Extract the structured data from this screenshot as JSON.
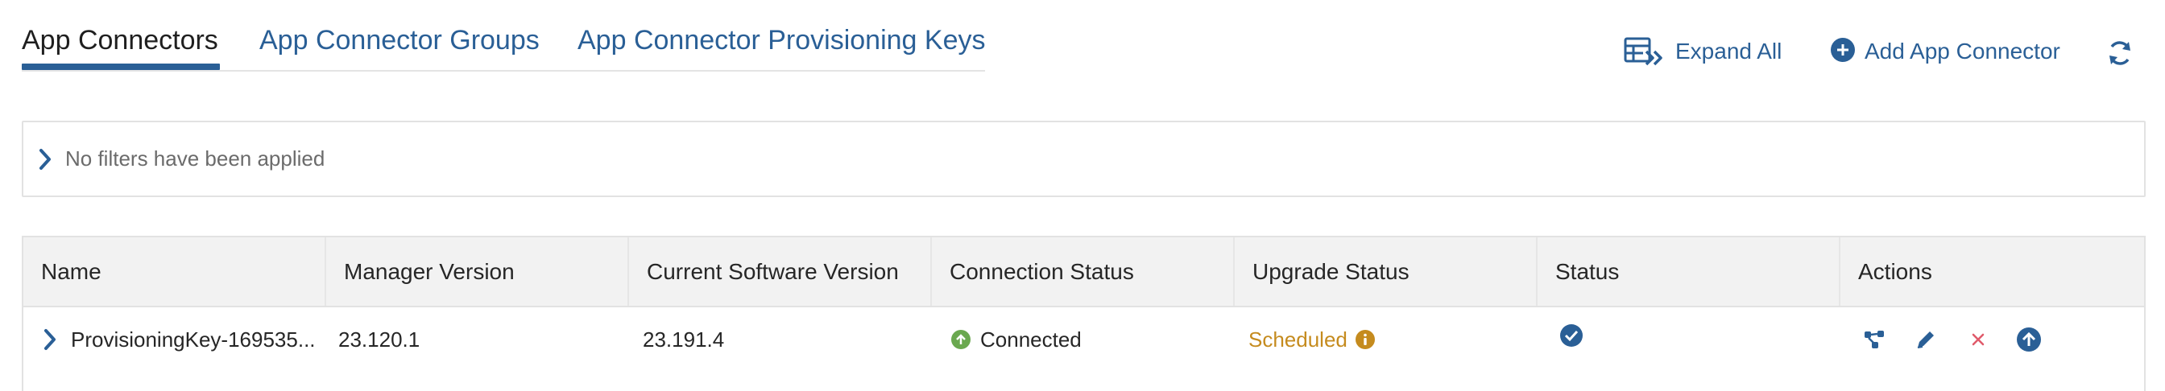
{
  "tabs": [
    {
      "label": "App Connectors",
      "active": true
    },
    {
      "label": "App Connector Groups",
      "active": false
    },
    {
      "label": "App Connector Provisioning Keys",
      "active": false
    }
  ],
  "toolbar": {
    "expand_all": {
      "label": "Expand All",
      "icon": "expand-all-icon"
    },
    "add_connector": {
      "label": "Add App Connector",
      "icon": "plus-circle-icon"
    },
    "refresh": {
      "icon": "refresh-icon"
    }
  },
  "filters": {
    "text": "No filters have been applied",
    "icon": "chevron-right-icon"
  },
  "table": {
    "columns": [
      "Name",
      "Manager Version",
      "Current Software Version",
      "Connection Status",
      "Upgrade Status",
      "Status",
      "Actions"
    ],
    "rows": [
      {
        "name": "ProvisioningKey-169535...",
        "manager_version": "23.120.1",
        "current_software_version": "23.191.4",
        "connection_status": "Connected",
        "upgrade_status": "Scheduled",
        "status_icon": "check-circle-icon",
        "actions": [
          "diagram-icon",
          "edit-icon",
          "delete-icon",
          "upgrade-icon"
        ]
      }
    ]
  },
  "colors": {
    "primary": "#2a5f96",
    "connected": "#6aa84f",
    "scheduled": "#c58b1e",
    "delete": "#e05a6a"
  }
}
